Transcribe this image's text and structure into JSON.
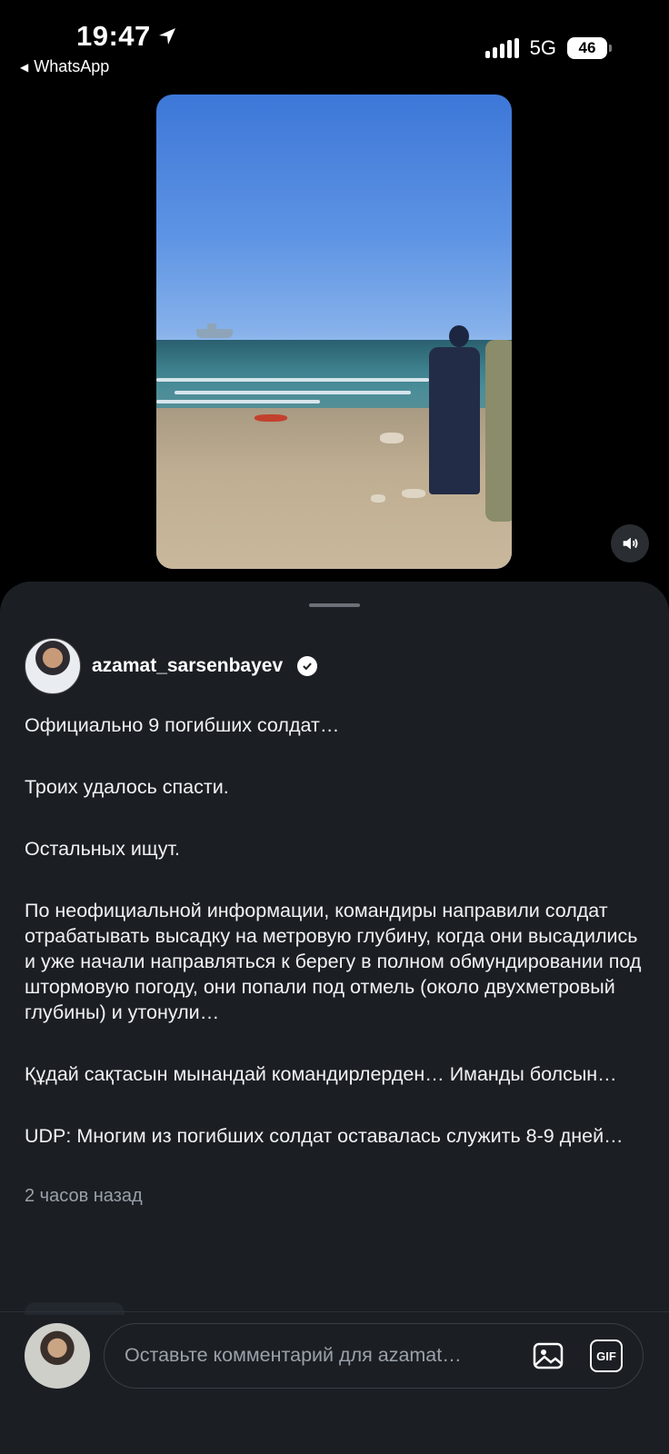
{
  "status_bar": {
    "time": "19:47",
    "back_app": "WhatsApp",
    "network": "5G",
    "battery": "46"
  },
  "video": {
    "mute_icon": "speaker-icon"
  },
  "post": {
    "username": "azamat_sarsenbayev",
    "verified_icon": "verified-badge-icon",
    "paragraphs": [
      "Официально 9 погибших солдат…",
      "Троих удалось спасти.",
      "Остальных ищут.",
      "По неофициальной информации, командиры направили солдат отрабатывать высадку на метровую глубину, когда они высадились и уже начали направляться к берегу в полном обмундировании под штормовую погоду, они попали под отмель (около двухметровый глубины) и утонули…",
      "Құдай сақтасын мынандай командирлерден… Иманды болсын…",
      "UDP: Многим из погибших солдат оставалась служить 8-9 дней…"
    ],
    "timestamp": "2 часов назад"
  },
  "comment_bar": {
    "placeholder": "Оставьте комментарий для azamat…",
    "gif_label": "GIF",
    "image_icon": "image-icon"
  }
}
